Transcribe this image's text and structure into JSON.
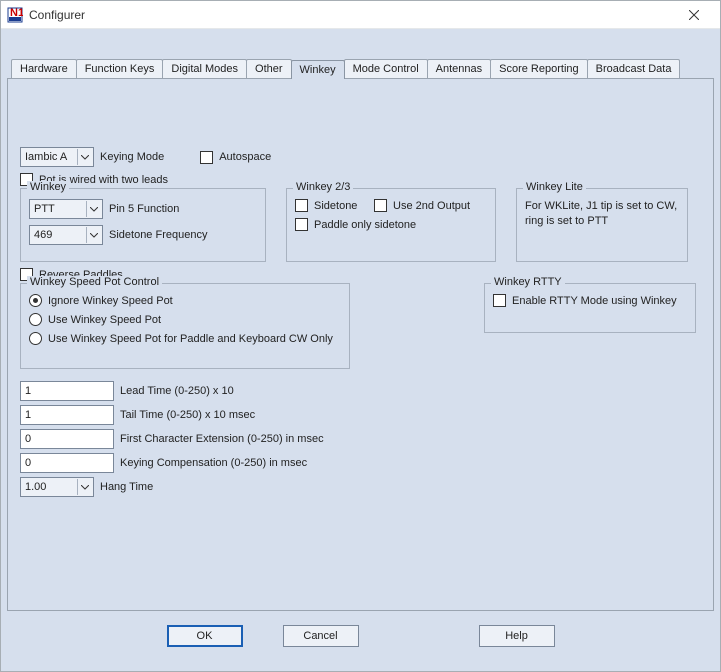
{
  "window": {
    "title": "Configurer"
  },
  "tabs": [
    "Hardware",
    "Function Keys",
    "Digital Modes",
    "Other",
    "Winkey",
    "Mode Control",
    "Antennas",
    "Score Reporting",
    "Broadcast Data"
  ],
  "activeTab": 4,
  "winkey": {
    "keyingMode": {
      "value": "Iambic A",
      "label": "Keying Mode"
    },
    "autospace": "Autospace",
    "potTwoLeads": "Pot is wired with two leads",
    "group1": {
      "legend": "Winkey",
      "pin5": {
        "value": "PTT",
        "label": "Pin 5 Function"
      },
      "sidetoneFreq": {
        "value": "469",
        "label": "Sidetone Frequency"
      }
    },
    "group2": {
      "legend": "Winkey 2/3",
      "sidetone": "Sidetone",
      "use2nd": "Use 2nd Output",
      "paddleOnly": "Paddle only sidetone"
    },
    "groupLite": {
      "legend": "Winkey Lite",
      "text": "For WKLite, J1 tip is set to CW, ring is set to PTT"
    },
    "reversePaddles": "Reverse Paddles",
    "speedPot": {
      "legend": "Winkey Speed Pot Control",
      "opt1": "Ignore Winkey Speed Pot",
      "opt2": "Use Winkey Speed Pot",
      "opt3": "Use Winkey Speed Pot for Paddle and Keyboard CW Only",
      "selected": 0
    },
    "groupRtty": {
      "legend": "Winkey RTTY",
      "enable": "Enable RTTY Mode using Winkey"
    },
    "fields": {
      "leadTime": {
        "value": "1",
        "label": "Lead Time (0-250) x 10"
      },
      "tailTime": {
        "value": "1",
        "label": "Tail Time (0-250) x 10 msec"
      },
      "firstChar": {
        "value": "0",
        "label": "First Character Extension (0-250) in msec"
      },
      "keyingComp": {
        "value": "0",
        "label": "Keying Compensation (0-250) in msec"
      },
      "hangTime": {
        "value": "1.00",
        "label": "Hang Time"
      }
    }
  },
  "buttons": {
    "ok": "OK",
    "cancel": "Cancel",
    "help": "Help"
  }
}
